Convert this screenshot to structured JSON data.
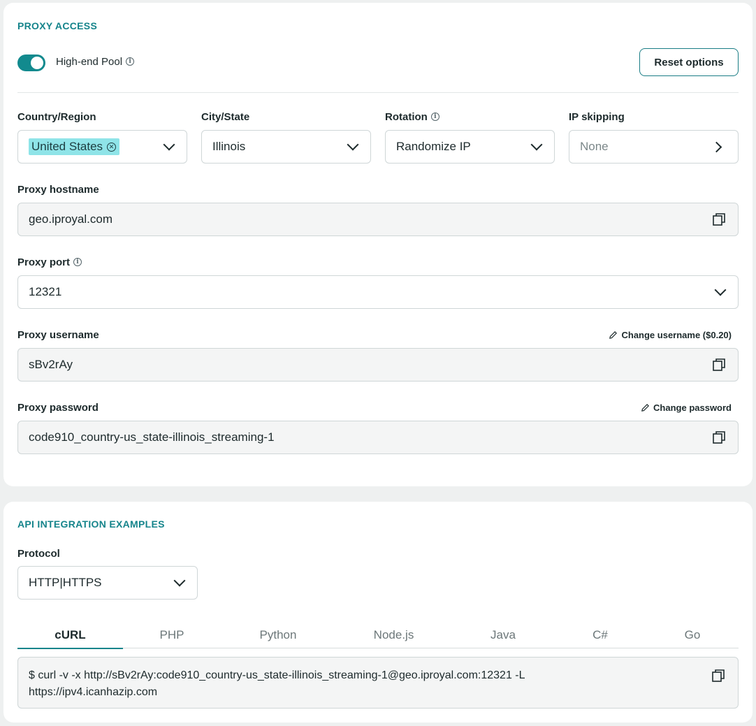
{
  "proxy_access": {
    "title": "PROXY ACCESS",
    "toggle_label": "High-end Pool",
    "toggle_on": true,
    "reset_button": "Reset options",
    "country": {
      "label": "Country/Region",
      "chip": "United States"
    },
    "city": {
      "label": "City/State",
      "value": "Illinois"
    },
    "rotation": {
      "label": "Rotation",
      "value": "Randomize IP"
    },
    "ip_skipping": {
      "label": "IP skipping",
      "placeholder": "None"
    },
    "hostname": {
      "label": "Proxy hostname",
      "value": "geo.iproyal.com"
    },
    "port": {
      "label": "Proxy port",
      "value": "12321"
    },
    "username": {
      "label": "Proxy username",
      "value": "sBv2rAy",
      "action": "Change username ($0.20)"
    },
    "password": {
      "label": "Proxy password",
      "value": "code910_country-us_state-illinois_streaming-1",
      "action": "Change password"
    }
  },
  "api_examples": {
    "title": "API INTEGRATION EXAMPLES",
    "protocol_label": "Protocol",
    "protocol_value": "HTTP|HTTPS",
    "tabs": [
      "cURL",
      "PHP",
      "Python",
      "Node.js",
      "Java",
      "C#",
      "Go"
    ],
    "active_tab": "cURL",
    "code_line1": "$ curl -v -x http://sBv2rAy:code910_country-us_state-illinois_streaming-1@geo.iproyal.com:12321 -L",
    "code_line2": "https://ipv4.icanhazip.com"
  },
  "colors": {
    "accent": "#128a8e",
    "section_title": "#15848b",
    "chip_bg": "#8fe4e8"
  }
}
